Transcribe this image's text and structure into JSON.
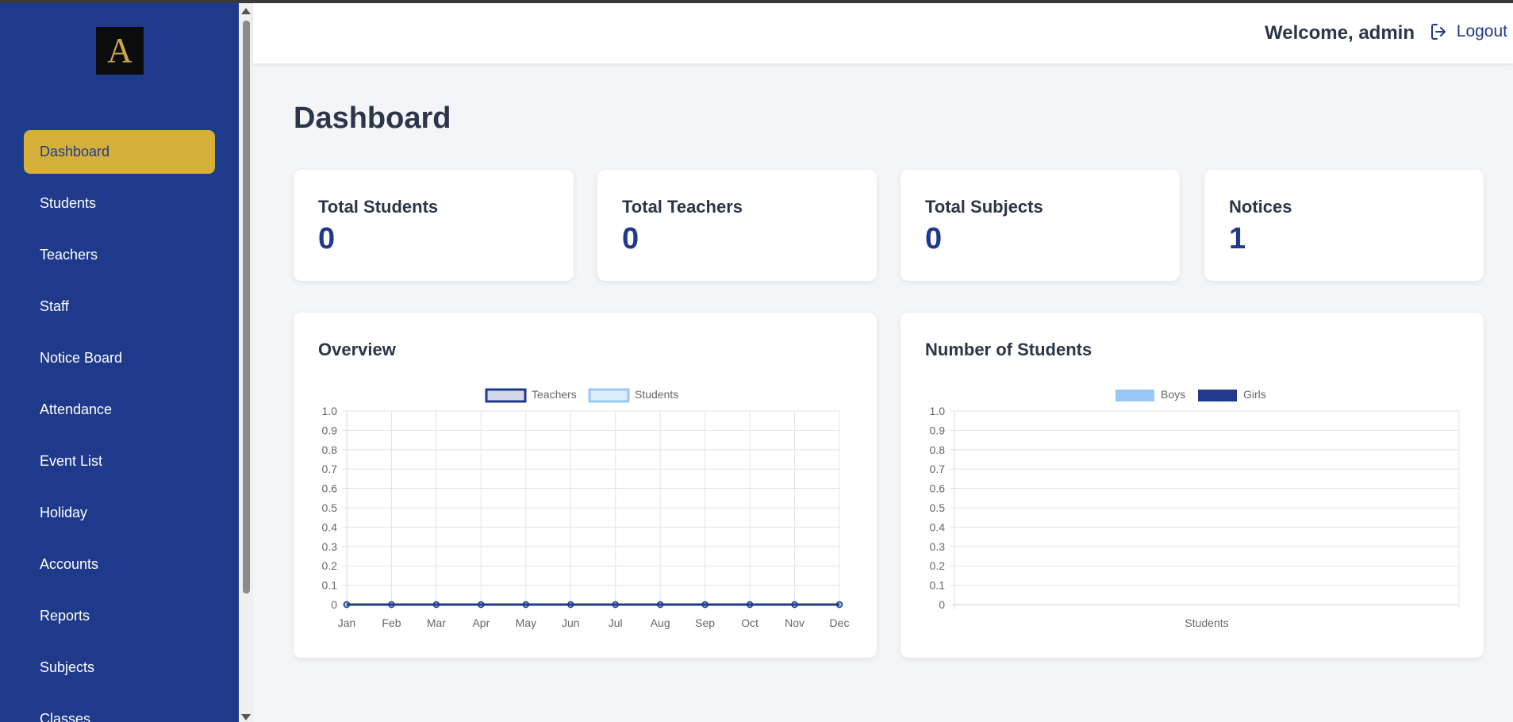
{
  "sidebar": {
    "logo_letter": "A",
    "items": [
      {
        "label": "Dashboard",
        "active": true
      },
      {
        "label": "Students"
      },
      {
        "label": "Teachers"
      },
      {
        "label": "Staff"
      },
      {
        "label": "Notice Board"
      },
      {
        "label": "Attendance"
      },
      {
        "label": "Event List"
      },
      {
        "label": "Holiday"
      },
      {
        "label": "Accounts"
      },
      {
        "label": "Reports"
      },
      {
        "label": "Subjects"
      },
      {
        "label": "Classes"
      }
    ]
  },
  "header": {
    "welcome": "Welcome, admin",
    "logout_label": "Logout"
  },
  "page_title": "Dashboard",
  "stats": [
    {
      "label": "Total Students",
      "value": "0"
    },
    {
      "label": "Total Teachers",
      "value": "0"
    },
    {
      "label": "Total Subjects",
      "value": "0"
    },
    {
      "label": "Notices",
      "value": "1"
    }
  ],
  "colors": {
    "sidebar_bg": "#1f3a8a",
    "accent": "#d4b03a",
    "primary": "#1f3a8a",
    "light_blue": "#99c8f7"
  },
  "chart_data": [
    {
      "type": "line",
      "title": "Overview",
      "categories": [
        "Jan",
        "Feb",
        "Mar",
        "Apr",
        "May",
        "Jun",
        "Jul",
        "Aug",
        "Sep",
        "Oct",
        "Nov",
        "Dec"
      ],
      "series": [
        {
          "name": "Teachers",
          "values": [
            0,
            0,
            0,
            0,
            0,
            0,
            0,
            0,
            0,
            0,
            0,
            0
          ],
          "color": "#1f3a8a"
        },
        {
          "name": "Students",
          "values": [
            0,
            0,
            0,
            0,
            0,
            0,
            0,
            0,
            0,
            0,
            0,
            0
          ],
          "color": "#99c8f7"
        }
      ],
      "yticks": [
        "0",
        "0.1",
        "0.2",
        "0.3",
        "0.4",
        "0.5",
        "0.6",
        "0.7",
        "0.8",
        "0.9",
        "1.0"
      ],
      "ylim": [
        0,
        1.0
      ],
      "grid": true,
      "legend": "top"
    },
    {
      "type": "bar",
      "title": "Number of Students",
      "categories": [
        "Students"
      ],
      "series": [
        {
          "name": "Boys",
          "values": [
            0
          ],
          "color": "#99c8f7"
        },
        {
          "name": "Girls",
          "values": [
            0
          ],
          "color": "#1f3a8a"
        }
      ],
      "yticks": [
        "0",
        "0.1",
        "0.2",
        "0.3",
        "0.4",
        "0.5",
        "0.6",
        "0.7",
        "0.8",
        "0.9",
        "1.0"
      ],
      "ylim": [
        0,
        1.0
      ],
      "grid": true,
      "legend": "top"
    }
  ]
}
